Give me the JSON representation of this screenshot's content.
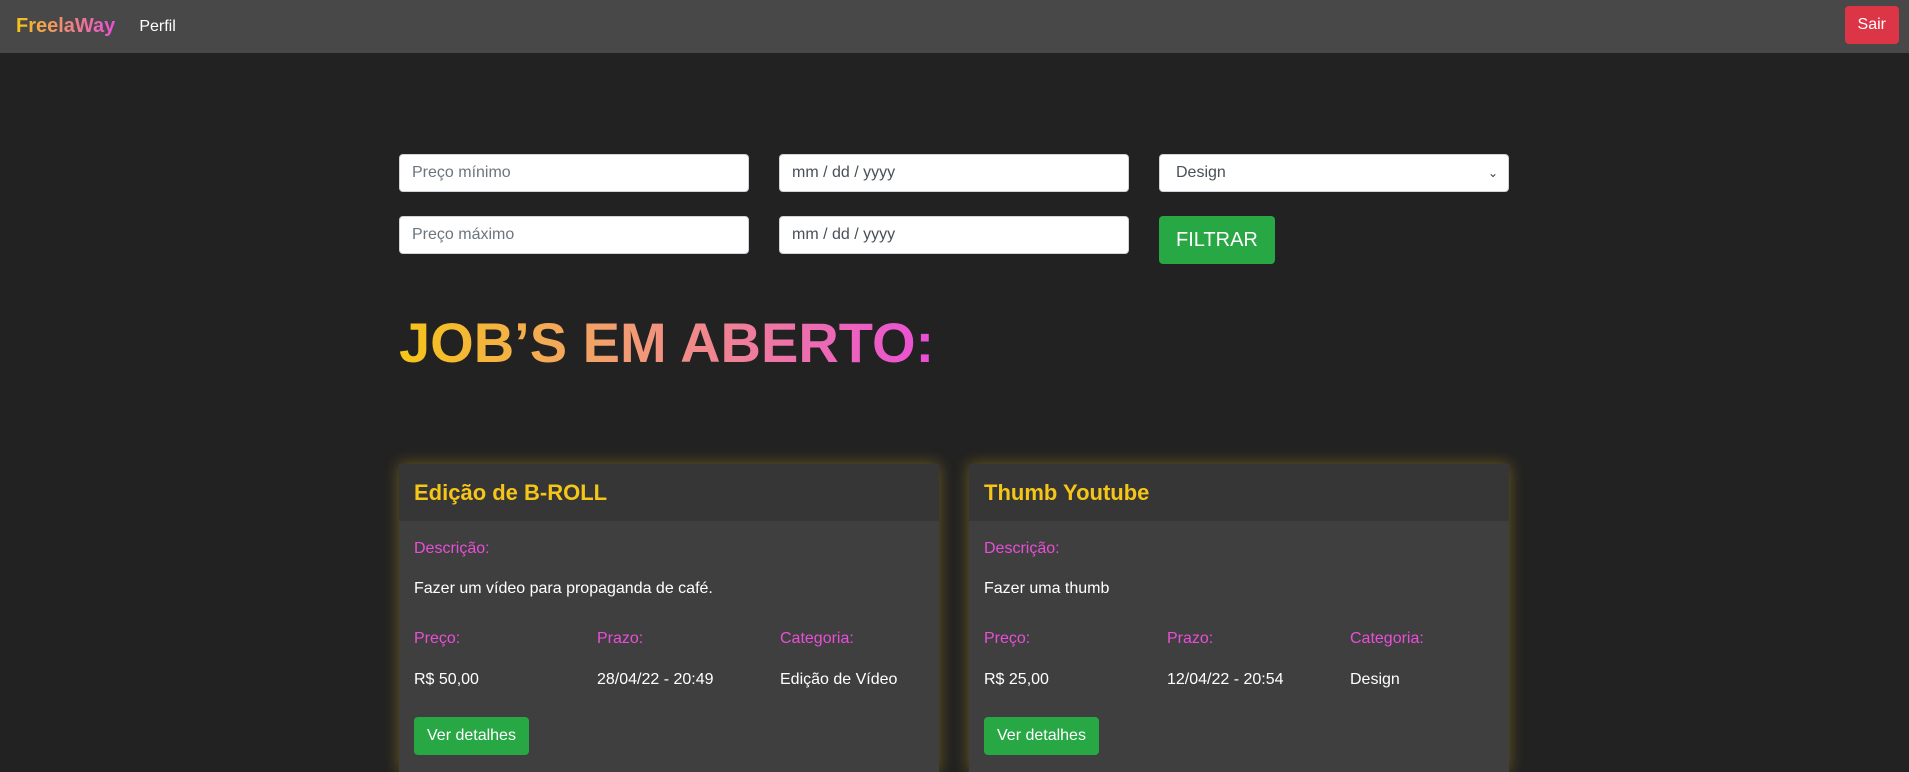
{
  "navbar": {
    "brand": "FreelaWay",
    "profile_link": "Perfil",
    "logout_label": "Sair"
  },
  "filters": {
    "min_price_placeholder": "Preço mínimo",
    "max_price_placeholder": "Preço máximo",
    "start_date_placeholder": "mm / dd / yyyy",
    "end_date_placeholder": "mm / dd / yyyy",
    "category_selected": "Design",
    "filter_button": "FILTRAR"
  },
  "section_title": "JOB’S EM ABERTO:",
  "labels": {
    "description": "Descrição:",
    "price": "Preço:",
    "deadline": "Prazo:",
    "category": "Categoria:",
    "details_button": "Ver detalhes"
  },
  "jobs": [
    {
      "title": "Edição de B-ROLL",
      "description": "Fazer um vídeo para propaganda de café.",
      "price": "R$ 50,00",
      "deadline": "28/04/22 - 20:49",
      "category": "Edição de Vídeo"
    },
    {
      "title": "Thumb Youtube",
      "description": "Fazer uma thumb",
      "price": "R$ 25,00",
      "deadline": "12/04/22 - 20:54",
      "category": "Design"
    }
  ],
  "colors": {
    "accent_yellow": "#f5c518",
    "accent_pink": "#e94ed8",
    "success": "#28a745",
    "danger": "#dc3545",
    "background": "#222222"
  }
}
